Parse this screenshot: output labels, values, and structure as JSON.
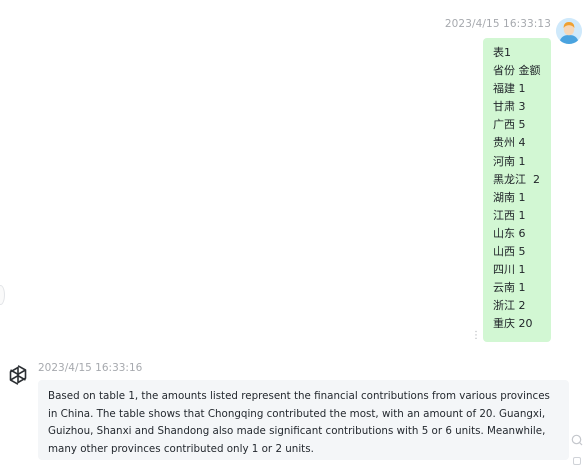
{
  "user_message": {
    "timestamp": "2023/4/15 16:33:13",
    "lines": [
      "表1",
      "省份 金额",
      "福建 1",
      "甘肃 3",
      "广西 5",
      "贵州 4",
      "河南 1",
      "黑龙江  2",
      "湖南 1",
      "江西 1",
      "山东 6",
      "山西 5",
      "四川 1",
      "云南 1",
      "浙江 2",
      "重庆 20"
    ],
    "more_icon": "⋮"
  },
  "bot_message": {
    "timestamp": "2023/4/15 16:33:16",
    "text": "Based on table 1, the amounts listed represent the financial contributions from various provinces in China. The table shows that Chongqing contributed the most, with an amount of 20. Guangxi, Guizhou, Shanxi and Shandong also made significant contributions with 5 or 6 units. Meanwhile, many other provinces contributed only 1 or 2 units."
  },
  "icons": {
    "user_avatar": "user-avatar",
    "bot_avatar": "openai-logo",
    "copy": "copy-icon"
  },
  "colors": {
    "user_bubble": "#d2f7d3",
    "bot_bubble": "#f4f6f8",
    "timestamp": "#a6a9ae"
  }
}
